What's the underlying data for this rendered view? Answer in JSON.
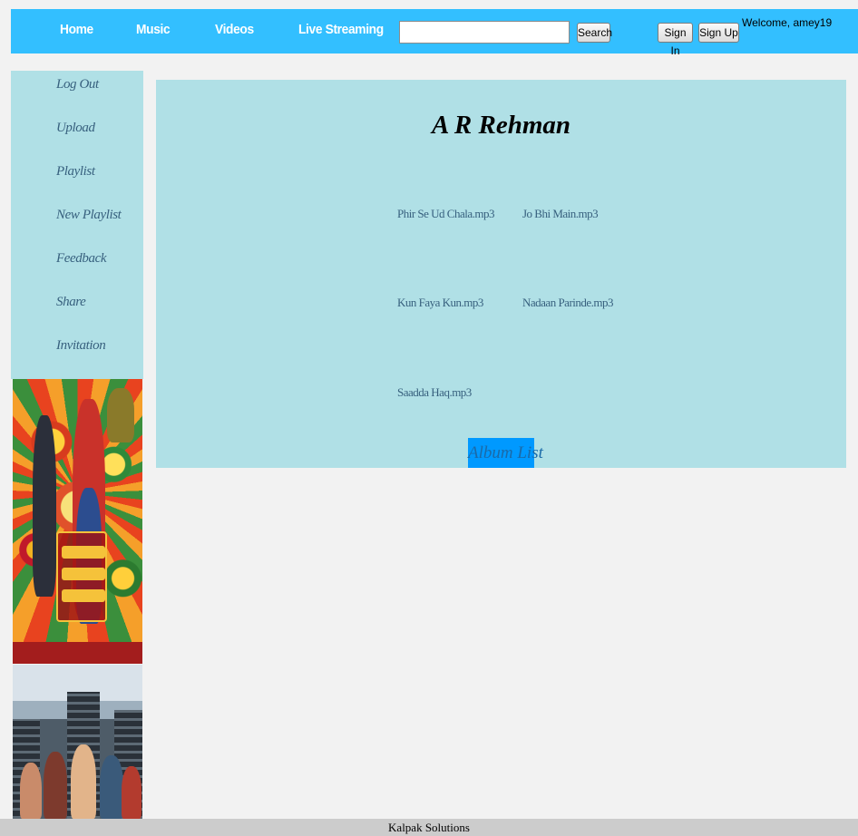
{
  "nav": {
    "links": [
      "Home",
      "Music",
      "Videos",
      "Live Streaming"
    ],
    "search_value": "",
    "search_button": "Search",
    "sign_in": "Sign In",
    "sign_up": "Sign Up",
    "welcome": "Welcome, amey19"
  },
  "sidebar": {
    "items": [
      "Log Out",
      "Upload",
      "Playlist",
      "New Playlist",
      "Feedback",
      "Share",
      "Invitation"
    ]
  },
  "content": {
    "artist": "A R Rehman",
    "songs": [
      "Phir Se Ud Chala.mp3",
      "Jo Bhi Main.mp3",
      "Kun Faya Kun.mp3",
      "Nadaan Parinde.mp3",
      "Saadda Haq.mp3"
    ],
    "album_list": "Album List"
  },
  "footer": {
    "text": "Kalpak Solutions"
  },
  "colors": {
    "nav_bar": "#33bfff",
    "panel": "#b0e0e6",
    "link_text": "#37607e",
    "album_button": "#0099ff",
    "footer": "#cccccc",
    "page_bg": "#f2f2f2"
  }
}
